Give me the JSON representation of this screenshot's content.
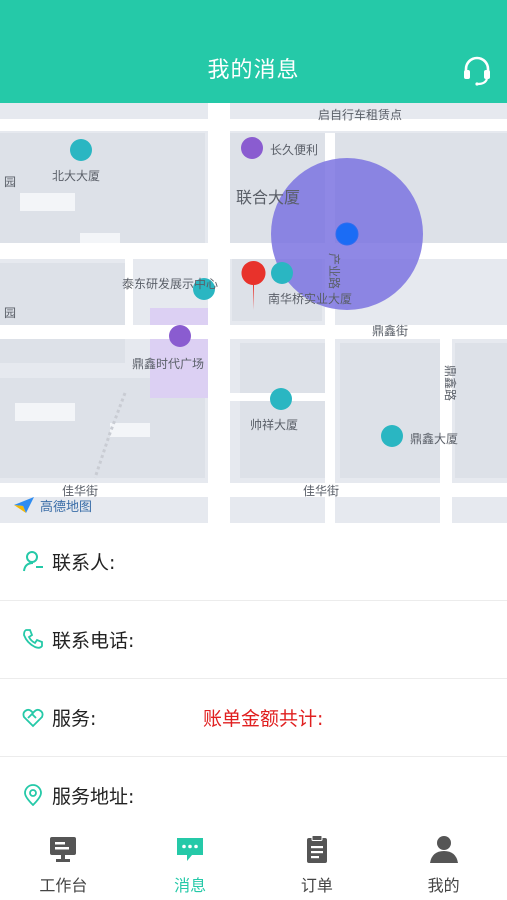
{
  "header": {
    "title": "我的消息",
    "support_icon": "headset-icon"
  },
  "map": {
    "logo_text": "高德地图",
    "labels": {
      "beida": "北大大厦",
      "changjiu": "长久便利",
      "zucheren": "启自行车租赁点",
      "lianhe": "联合大厦",
      "chanyelu": "产业路",
      "zhanshi": "泰东研发展示中心",
      "nanhua": "南华桥实业大厦",
      "dingxin": "鼎鑫时代广场",
      "dingxinjie": "鼎鑫街",
      "dingxinlu": "鼎鑫路",
      "shuaixiang": "帅祥大厦",
      "dingxindasha": "鼎鑫大厦",
      "jiahuajie": "佳华街",
      "left1": "园",
      "left2": "园"
    },
    "colors": {
      "accuracy_circle": "#7b73e0",
      "pin": "#e8322b",
      "poi": "#2ab6c2",
      "shop": "#8a5cd0"
    }
  },
  "form": {
    "contact": {
      "label": "联系人:",
      "icon": "person-icon"
    },
    "phone": {
      "label": "联系电话:",
      "icon": "phone-icon"
    },
    "service": {
      "label": "服务:",
      "icon": "handshake-icon",
      "total_label": "账单金额共计:"
    },
    "address": {
      "label": "服务地址:",
      "icon": "location-pin-icon"
    }
  },
  "tabs": [
    {
      "label": "工作台",
      "icon": "monitor-icon",
      "active": false
    },
    {
      "label": "消息",
      "icon": "chat-icon",
      "active": true
    },
    {
      "label": "订单",
      "icon": "clipboard-icon",
      "active": false
    },
    {
      "label": "我的",
      "icon": "user-icon",
      "active": false
    }
  ],
  "colors": {
    "brand": "#25c9a8",
    "alert_text": "#e02020"
  }
}
